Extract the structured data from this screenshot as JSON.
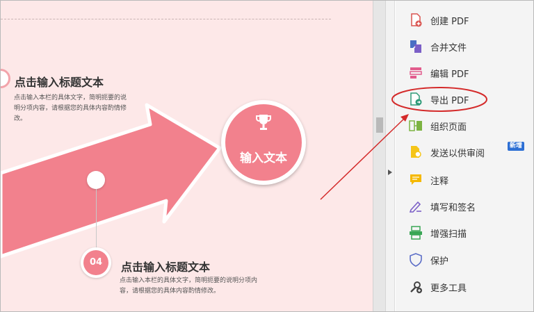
{
  "slide": {
    "heading_top": "点击输入标题文本",
    "body_top": "点击输入本栏的具体文字，简明扼要的说明分项内容，请根据您的具体内容酌情修改。",
    "trophy_label": "输入文本",
    "badge_number": "04",
    "heading_bottom": "点击输入标题文本",
    "body_bottom": "点击输入本栏的具体文字，简明扼要的说明分项内容，请根据您的具体内容酌情修改。"
  },
  "tools": {
    "items": [
      {
        "label": "创建 PDF",
        "icon": "create-pdf-icon"
      },
      {
        "label": "合并文件",
        "icon": "combine-files-icon"
      },
      {
        "label": "编辑 PDF",
        "icon": "edit-pdf-icon"
      },
      {
        "label": "导出 PDF",
        "icon": "export-pdf-icon"
      },
      {
        "label": "组织页面",
        "icon": "organize-pages-icon"
      },
      {
        "label": "发送以供审阅",
        "icon": "send-for-review-icon",
        "badge": "新增"
      },
      {
        "label": "注释",
        "icon": "comment-icon"
      },
      {
        "label": "填写和签名",
        "icon": "fill-sign-icon"
      },
      {
        "label": "增强扫描",
        "icon": "enhance-scan-icon"
      },
      {
        "label": "保护",
        "icon": "protect-icon"
      },
      {
        "label": "更多工具",
        "icon": "more-tools-icon"
      }
    ]
  },
  "colors": {
    "slide_bg": "#fde8e8",
    "arrow_pink": "#f2818d",
    "annotation_red": "#d42a2a",
    "new_badge_blue": "#2d6fd4"
  }
}
